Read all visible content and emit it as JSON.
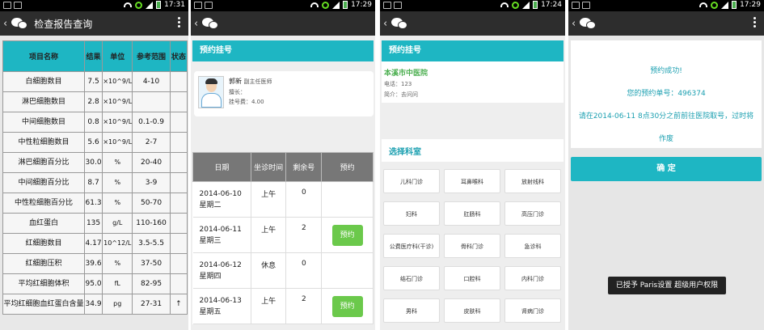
{
  "panel1": {
    "status_time": "17:31",
    "title": "检查报告查询",
    "headers": [
      "项目名称",
      "结果",
      "单位",
      "参考范围",
      "状态"
    ],
    "rows": [
      [
        "白细胞数目",
        "7.5",
        "×10^9/L",
        "4-10",
        ""
      ],
      [
        "淋巴细胞数目",
        "2.8",
        "×10^9/L",
        "",
        ""
      ],
      [
        "中间细胞数目",
        "0.8",
        "×10^9/L",
        "0.1-0.9",
        ""
      ],
      [
        "中性粒细胞数目",
        "5.6",
        "×10^9/L",
        "2-7",
        ""
      ],
      [
        "淋巴细胞百分比",
        "30.0",
        "%",
        "20-40",
        ""
      ],
      [
        "中间细胞百分比",
        "8.7",
        "%",
        "3-9",
        ""
      ],
      [
        "中性粒细胞百分比",
        "61.3",
        "%",
        "50-70",
        ""
      ],
      [
        "血红蛋白",
        "135",
        "g/L",
        "110-160",
        ""
      ],
      [
        "红细胞数目",
        "4.17",
        "10^12/L",
        "3.5-5.5",
        ""
      ],
      [
        "红细胞压积",
        "39.6",
        "%",
        "37-50",
        ""
      ],
      [
        "平均红细胞体积",
        "95.0",
        "fL",
        "82-95",
        ""
      ],
      [
        "平均红细胞血红蛋白含量",
        "34.9",
        "pg",
        "27-31",
        "↑"
      ]
    ]
  },
  "panel2": {
    "status_time": "17:29",
    "header": "预约挂号",
    "doctor": {
      "name": "郭新",
      "title": "副主任医师",
      "speciality": "擅长：",
      "fee": "挂号费：4.00"
    },
    "sched_headers": [
      "日期",
      "坐诊时间",
      "剩余号",
      "预约"
    ],
    "sched_rows": [
      {
        "date": "2014-06-10",
        "week": "星期二",
        "time": "上午",
        "remain": "0",
        "action": ""
      },
      {
        "date": "2014-06-11",
        "week": "星期三",
        "time": "上午",
        "remain": "2",
        "action": "预约"
      },
      {
        "date": "2014-06-12",
        "week": "星期四",
        "time": "休息",
        "remain": "0",
        "action": ""
      },
      {
        "date": "2014-06-13",
        "week": "星期五",
        "time": "上午",
        "remain": "2",
        "action": "预约"
      }
    ]
  },
  "panel3": {
    "status_time": "17:24",
    "header": "预约挂号",
    "hospital": "本溪市中医院",
    "phone": "电话：123",
    "intro": "简介：去问问",
    "dept_title": "选择科室",
    "depts": [
      "儿科门诊",
      "耳鼻喉科",
      "放射线科",
      "妇科",
      "肛肠科",
      "高压门诊",
      "公费医疗科(干诊)",
      "骨科门诊",
      "急诊科",
      "结石门诊",
      "口腔科",
      "内科门诊",
      "男科",
      "皮肤科",
      "肾病门诊"
    ]
  },
  "panel4": {
    "status_time": "17:29",
    "line1": "预约成功!",
    "line2": "您的预约单号：496374",
    "line3a": "请在2014-06-11 8点30分之前前往医院取号，过时将",
    "line3b": "作废",
    "confirm": "确 定",
    "toast": "已授予 Paris设置 超级用户权限"
  },
  "colors": {
    "teal": "#1eb6c3",
    "green": "#6bc94b",
    "hospital_green": "#4caf50"
  }
}
